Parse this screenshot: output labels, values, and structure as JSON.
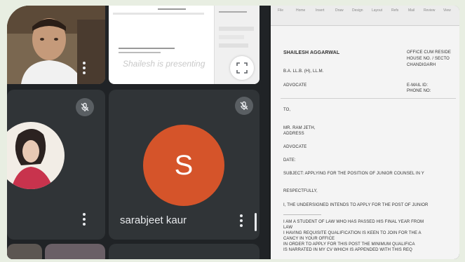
{
  "meeting": {
    "presenting_text": "Shailesh is presenting",
    "participants": [
      {
        "name": "sarabjeet kaur",
        "initial": "S",
        "avatar_color": "#d5542a"
      }
    ]
  },
  "colors": {
    "tile_bg": "#303437",
    "grid_bg": "#202326",
    "avatar_orange": "#d5542a"
  },
  "icons": [
    "mic-off-icon",
    "more-vert-icon",
    "fullscreen-icon"
  ],
  "document": {
    "ribbon": [
      "File",
      "Home",
      "Insert",
      "Draw",
      "Design",
      "Layout",
      "Refs",
      "Mail",
      "Review",
      "View"
    ],
    "sender_name": "SHAILESH AGGARWAL",
    "qualification": "B.A. LL.B. (H), LL.M.",
    "designation": "ADVOCATE",
    "office_label": "OFFICE CUM RESIDE",
    "address_line1": "HOUSE NO. / SECTO",
    "address_line2": "CHANDIGARH",
    "email_label": "E-MAIL ID:",
    "phone_label": "PHONE NO:",
    "to": "TO,",
    "recipient": "MR. RAM JETH,",
    "recipient_address": "ADDRESS",
    "recipient_designation": "ADVOCATE",
    "date": "DATE:",
    "subject": "SUBJECT: APPLYING FOR THE POSITION OF JUNIOR COUNSEL IN Y",
    "salutation": "RESPECTFULLY,",
    "para1": "I, THE UNDERSIGNED INTENDS TO APPLY FOR THE POST OF JUNIOR",
    "para2_1": "I AM A STUDENT OF LAW WHO HAS PASSED HIS FINAL YEAR FROM",
    "para2_2": "LAW",
    "para2_3": "I HAVING REQUISITE QUALIFICATION IS KEEN TO JOIN FOR THE A",
    "para2_4": "CANCY IN YOUR OFFICE",
    "para2_5": "IN ORDER TO APPLY FOR THIS POST THE MINIMUM QUALIFICA",
    "para2_6": "IS NARRATED IN MY CV WHICH IS APPENDED WITH THIS REQ"
  }
}
